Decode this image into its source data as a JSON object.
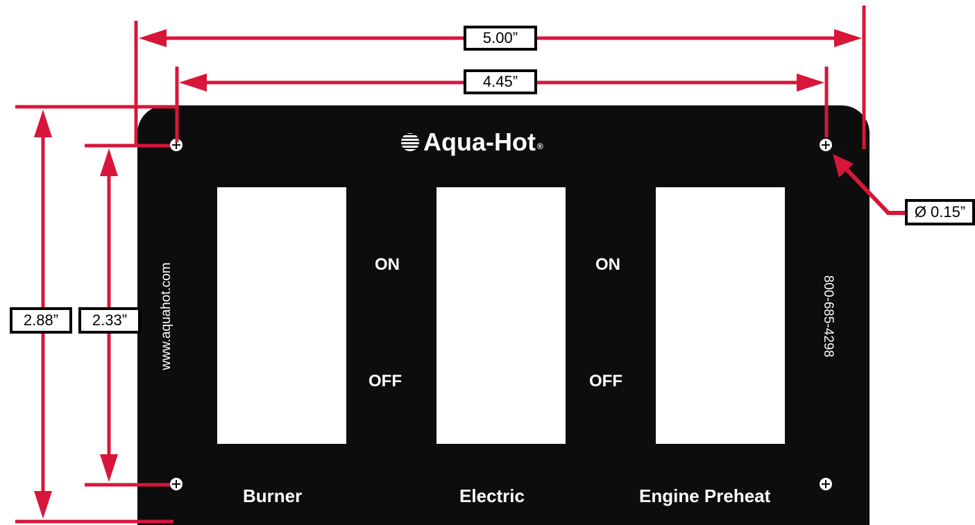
{
  "panel": {
    "brand": "Aqua-Hot",
    "brand_mark": "®",
    "website": "www.aquahot.com",
    "phone": "800-685-4298",
    "switches": [
      {
        "name": "Burner"
      },
      {
        "name": "Electric"
      },
      {
        "name": "Engine Preheat"
      }
    ],
    "state_labels": [
      {
        "on": "ON",
        "off": "OFF"
      },
      {
        "on": "ON",
        "off": "OFF"
      }
    ]
  },
  "dimensions": {
    "overall_width": "5.00”",
    "hole_spacing_width": "4.45”",
    "overall_height": "2.88”",
    "hole_spacing_height": "2.33”",
    "hole_diameter": "Ø 0.15”"
  },
  "colors": {
    "panel": "#0d0d0d",
    "dimension_line": "#d8163a",
    "label_border": "#000000"
  },
  "icons": [
    "screw-hole-icon",
    "aqua-hot-logo-icon"
  ]
}
